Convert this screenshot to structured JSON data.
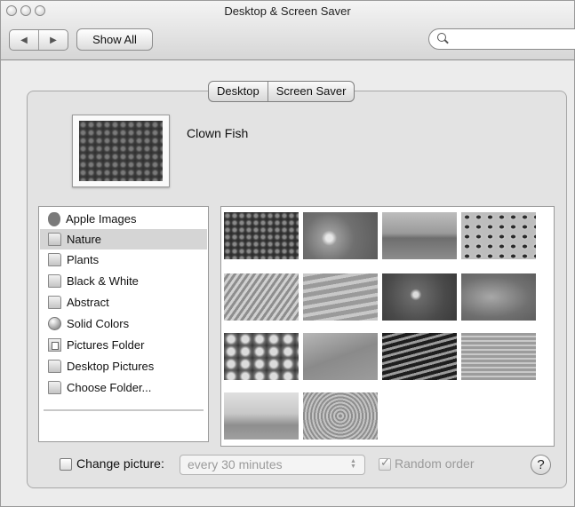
{
  "window": {
    "title": "Desktop & Screen Saver"
  },
  "toolbar": {
    "show_all_label": "Show All",
    "search_value": ""
  },
  "tabs": [
    {
      "label": "Desktop",
      "selected": true
    },
    {
      "label": "Screen Saver",
      "selected": false
    }
  ],
  "preview": {
    "name": "Clown Fish"
  },
  "sidebar": {
    "items": [
      {
        "label": "Apple Images",
        "icon": "apple-icon"
      },
      {
        "label": "Nature",
        "icon": "folder-icon",
        "selected": true
      },
      {
        "label": "Plants",
        "icon": "folder-icon"
      },
      {
        "label": "Black & White",
        "icon": "folder-icon"
      },
      {
        "label": "Abstract",
        "icon": "folder-icon"
      },
      {
        "label": "Solid Colors",
        "icon": "globe-icon"
      },
      {
        "label": "Pictures Folder",
        "icon": "pictures-folder-icon"
      },
      {
        "label": "Desktop Pictures",
        "icon": "folder-icon"
      },
      {
        "label": "Choose Folder...",
        "icon": "folder-icon"
      }
    ]
  },
  "thumbnails": {
    "count": 14,
    "items": [
      {
        "name": "clown-fish",
        "selected": true
      },
      {
        "name": "drop"
      },
      {
        "name": "mist"
      },
      {
        "name": "leopard"
      },
      {
        "name": "dune-waves"
      },
      {
        "name": "ripples"
      },
      {
        "name": "fish"
      },
      {
        "name": "water-swirl"
      },
      {
        "name": "pebbles"
      },
      {
        "name": "dunes"
      },
      {
        "name": "zebra"
      },
      {
        "name": "lake"
      },
      {
        "name": "horizon"
      },
      {
        "name": "sand-pattern"
      }
    ]
  },
  "options": {
    "change_picture_label": "Change picture:",
    "change_picture_checked": false,
    "interval_value": "every 30 minutes",
    "random_order_label": "Random order",
    "random_order_checked": true,
    "help_label": "?"
  }
}
